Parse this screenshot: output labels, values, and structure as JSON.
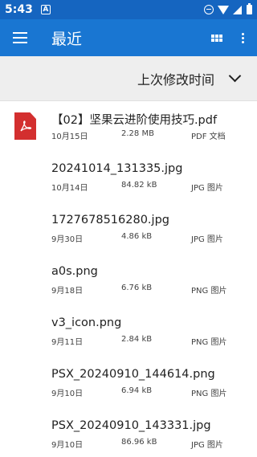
{
  "status_bar": {
    "time": "5:43",
    "notification_icon": "A"
  },
  "app_bar": {
    "title": "最近"
  },
  "sort_bar": {
    "label": "上次修改时间"
  },
  "files": [
    {
      "name": "【02】坚果云进阶使用技巧.pdf",
      "date": "10月15日",
      "size": "2.28 MB",
      "type": "PDF 文档",
      "icon": "pdf-icon"
    },
    {
      "name": "20241014_131335.jpg",
      "date": "10月14日",
      "size": "84.82 kB",
      "type": "JPG 图片",
      "icon": ""
    },
    {
      "name": "1727678516280.jpg",
      "date": "9月30日",
      "size": "4.86 kB",
      "type": "JPG 图片",
      "icon": ""
    },
    {
      "name": "a0s.png",
      "date": "9月18日",
      "size": "6.76 kB",
      "type": "PNG 图片",
      "icon": ""
    },
    {
      "name": "v3_icon.png",
      "date": "9月11日",
      "size": "2.84 kB",
      "type": "PNG 图片",
      "icon": ""
    },
    {
      "name": "PSX_20240910_144614.png",
      "date": "9月10日",
      "size": "6.94 kB",
      "type": "PNG 图片",
      "icon": ""
    },
    {
      "name": "PSX_20240910_143331.jpg",
      "date": "9月10日",
      "size": "86.96 kB",
      "type": "JPG 图片",
      "icon": ""
    }
  ]
}
